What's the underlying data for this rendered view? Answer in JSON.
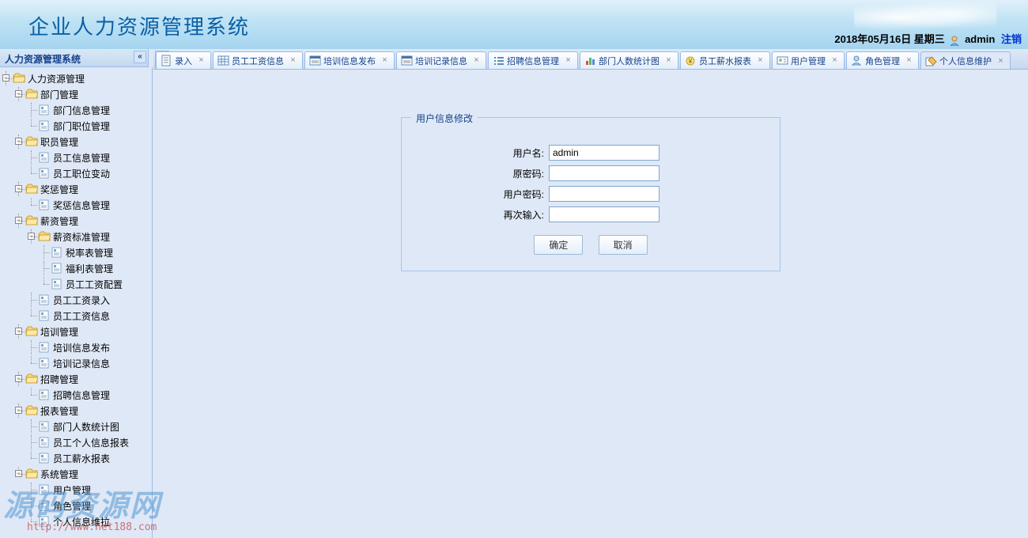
{
  "header": {
    "title": "企业人力资源管理系统",
    "date": "2018年05月16日 星期三",
    "user": "admin",
    "logout": "注销"
  },
  "sidebar": {
    "title": "人力资源管理系统",
    "root": "人力资源管理",
    "groups": [
      {
        "label": "部门管理",
        "items": [
          "部门信息管理",
          "部门职位管理"
        ]
      },
      {
        "label": "职员管理",
        "items": [
          "员工信息管理",
          "员工职位变动"
        ]
      },
      {
        "label": "奖惩管理",
        "items": [
          "奖惩信息管理"
        ]
      },
      {
        "label": "薪资管理",
        "sub": {
          "label": "薪资标准管理",
          "items": [
            "税率表管理",
            "福利表管理",
            "员工工资配置"
          ]
        },
        "items": [
          "员工工资录入",
          "员工工资信息"
        ]
      },
      {
        "label": "培训管理",
        "items": [
          "培训信息发布",
          "培训记录信息"
        ]
      },
      {
        "label": "招聘管理",
        "items": [
          "招聘信息管理"
        ]
      },
      {
        "label": "报表管理",
        "items": [
          "部门人数统计图",
          "员工个人信息报表",
          "员工薪水报表"
        ]
      },
      {
        "label": "系统管理",
        "items": [
          "用户管理",
          "角色管理",
          "个人信息维拉"
        ]
      }
    ]
  },
  "tabs": [
    {
      "label": "录入",
      "icon": "doc",
      "partial": true
    },
    {
      "label": "员工工资信息",
      "icon": "grid"
    },
    {
      "label": "培训信息发布",
      "icon": "lines"
    },
    {
      "label": "培训记录信息",
      "icon": "lines"
    },
    {
      "label": "招聘信息管理",
      "icon": "list"
    },
    {
      "label": "部门人数统计图",
      "icon": "chart"
    },
    {
      "label": "员工薪水报表",
      "icon": "money"
    },
    {
      "label": "用户管理",
      "icon": "user-card"
    },
    {
      "label": "角色管理",
      "icon": "role"
    },
    {
      "label": "个人信息维护",
      "icon": "edit",
      "active": true
    }
  ],
  "form": {
    "legend": "用户信息修改",
    "fields": {
      "username": {
        "label": "用户名:",
        "value": "admin"
      },
      "oldpwd": {
        "label": "原密码:",
        "value": ""
      },
      "newpwd": {
        "label": "用户密码:",
        "value": ""
      },
      "confirm": {
        "label": "再次输入:",
        "value": ""
      }
    },
    "ok": "确定",
    "cancel": "取消"
  },
  "watermark": {
    "main": "源码资源网",
    "url": "http://www.net188.com"
  }
}
